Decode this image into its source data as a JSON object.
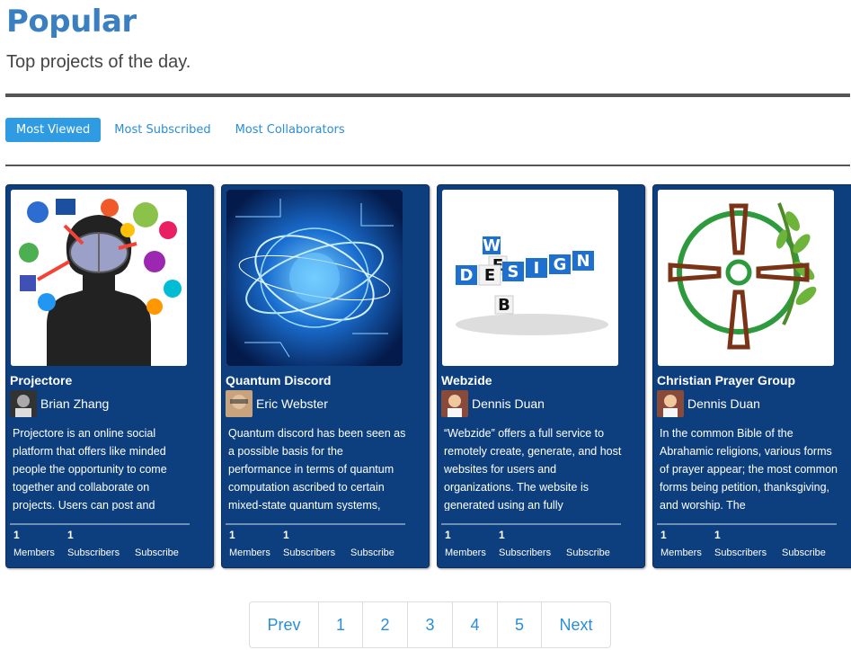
{
  "header": {
    "title": "Popular",
    "subtitle": "Top projects of the day."
  },
  "tabs": [
    {
      "label": "Most Viewed",
      "active": true
    },
    {
      "label": "Most Subscribed",
      "active": false
    },
    {
      "label": "Most Collaborators",
      "active": false
    }
  ],
  "cards": [
    {
      "title": "Projectore",
      "author": "Brian Zhang",
      "description": "Projectore is an online social platform that offers like minded people the opportunity to come together and collaborate on projects. Users can post and",
      "members_count": "1",
      "members_label": "Members",
      "subscribers_count": "1",
      "subscribers_label": "Subscribers",
      "subscribe_label": "Subscribe"
    },
    {
      "title": "Quantum Discord",
      "author": "Eric Webster",
      "description": "Quantum discord has been seen as a possible basis for the performance in terms of quantum computation ascribed to certain mixed-state quantum systems,",
      "members_count": "1",
      "members_label": "Members",
      "subscribers_count": "1",
      "subscribers_label": "Subscribers",
      "subscribe_label": "Subscribe"
    },
    {
      "title": "Webzide",
      "author": "Dennis Duan",
      "description": "“Webzide” offers a full service to remotely create, generate, and host websites for users and organizations. The website is generated using an fully",
      "members_count": "1",
      "members_label": "Members",
      "subscribers_count": "1",
      "subscribers_label": "Subscribers",
      "subscribe_label": "Subscribe",
      "image_text_1": "WEB",
      "image_text_2": "DESIGN"
    },
    {
      "title": "Christian Prayer Group",
      "author": "Dennis Duan",
      "description": "In the common Bible of the Abrahamic religions, various forms of prayer appear; the most common forms being petition, thanksgiving, and worship. The",
      "members_count": "1",
      "members_label": "Members",
      "subscribers_count": "1",
      "subscribers_label": "Subscribers",
      "subscribe_label": "Subscribe"
    }
  ],
  "pagination": {
    "prev": "Prev",
    "pages": [
      "1",
      "2",
      "3",
      "4",
      "5"
    ],
    "next": "Next"
  }
}
